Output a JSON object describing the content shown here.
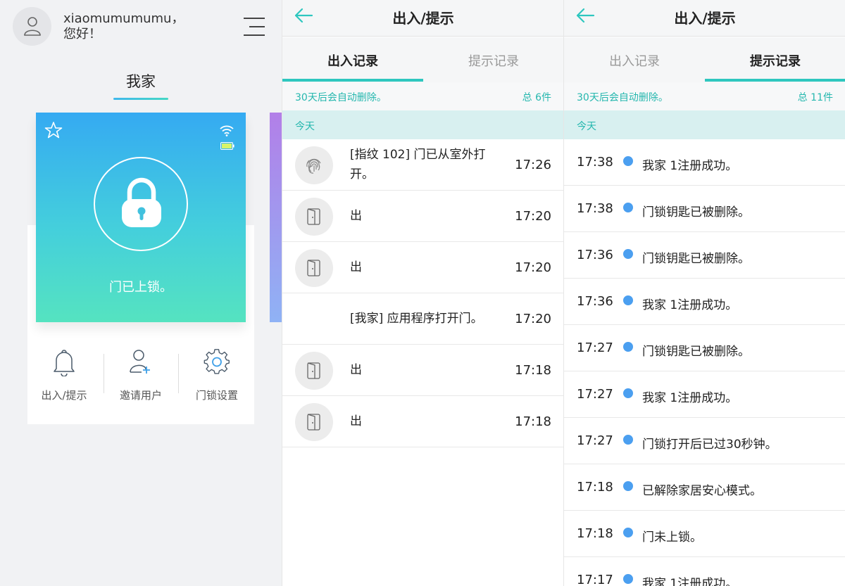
{
  "home": {
    "greeting_line1": "xiaomumumumu，",
    "greeting_line2": "您好！",
    "home_tab": "我家",
    "lock_status": "门已上锁。",
    "actions": [
      {
        "label": "出入/提示",
        "icon": "bell-icon"
      },
      {
        "label": "邀请用户",
        "icon": "add-user-icon"
      },
      {
        "label": "门锁设置",
        "icon": "gear-icon"
      }
    ]
  },
  "entry_screen": {
    "title": "出入/提示",
    "tabs": [
      "出入记录",
      "提示记录"
    ],
    "active_tab": 0,
    "auto_delete": "30天后会自动删除。",
    "total": "总 6件",
    "section": "今天",
    "records": [
      {
        "icon": "fingerprint-icon",
        "text": "[指纹 102] 门已从室外打开。",
        "time": "17:26"
      },
      {
        "icon": "door-icon",
        "text": "出",
        "time": "17:20"
      },
      {
        "icon": "door-icon",
        "text": "出",
        "time": "17:20"
      },
      {
        "icon": "",
        "text": "[我家] 应用程序打开门。",
        "time": "17:20"
      },
      {
        "icon": "door-icon",
        "text": "出",
        "time": "17:18"
      },
      {
        "icon": "door-icon",
        "text": "出",
        "time": "17:18"
      }
    ]
  },
  "notice_screen": {
    "title": "出入/提示",
    "tabs": [
      "出入记录",
      "提示记录"
    ],
    "active_tab": 1,
    "auto_delete": "30天后会自动删除。",
    "total": "总 11件",
    "section": "今天",
    "records": [
      {
        "time": "17:38",
        "text": "我家 1注册成功。"
      },
      {
        "time": "17:38",
        "text": "门锁钥匙已被删除。"
      },
      {
        "time": "17:36",
        "text": "门锁钥匙已被删除。"
      },
      {
        "time": "17:36",
        "text": "我家 1注册成功。"
      },
      {
        "time": "17:27",
        "text": "门锁钥匙已被删除。"
      },
      {
        "time": "17:27",
        "text": "我家 1注册成功。"
      },
      {
        "time": "17:27",
        "text": "门锁打开后已过30秒钟。"
      },
      {
        "time": "17:18",
        "text": "已解除家居安心模式。"
      },
      {
        "time": "17:18",
        "text": "门未上锁。"
      },
      {
        "time": "17:17",
        "text": "我家 1注册成功。"
      }
    ]
  },
  "colors": {
    "accent": "#2ec7bf",
    "dot": "#4b9ff0",
    "card_top": "#35aaf2",
    "card_bottom": "#55e3c0"
  }
}
